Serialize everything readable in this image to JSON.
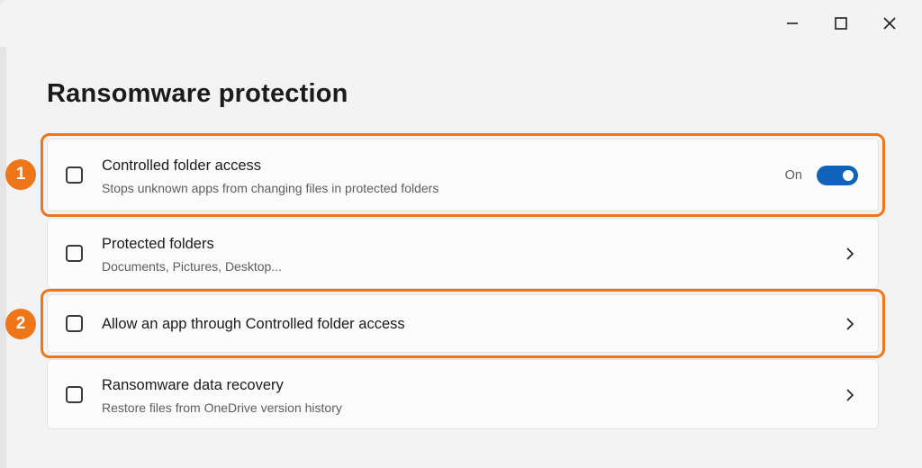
{
  "window": {
    "controls": [
      {
        "name": "minimize-button",
        "icon": "minimize-icon"
      },
      {
        "name": "maximize-button",
        "icon": "maximize-icon"
      },
      {
        "name": "close-button",
        "icon": "close-icon"
      }
    ]
  },
  "page": {
    "title": "Ransomware protection"
  },
  "cards": [
    {
      "title": "Controlled folder access",
      "subtitle": "Stops unknown apps from changing files in protected folders",
      "icon": "folder-lock-icon",
      "toggle_state": "On",
      "toggle_on": true
    },
    {
      "title": "Protected folders",
      "subtitle": "Documents, Pictures, Desktop...",
      "icon": "folder-shield-icon",
      "action_icon": "chevron-right-icon"
    },
    {
      "title": "Allow an app through Controlled folder access",
      "icon": "app-allow-icon",
      "action_icon": "chevron-right-icon"
    },
    {
      "title": "Ransomware data recovery",
      "subtitle": "Restore files from OneDrive version history",
      "icon": "cloud-restore-icon",
      "action_icon": "chevron-right-icon"
    }
  ],
  "annotations": {
    "step1": "1",
    "step2": "2",
    "color": "#ee7518"
  },
  "colors": {
    "accent": "#0f63b8",
    "annotation": "#ee7518"
  }
}
